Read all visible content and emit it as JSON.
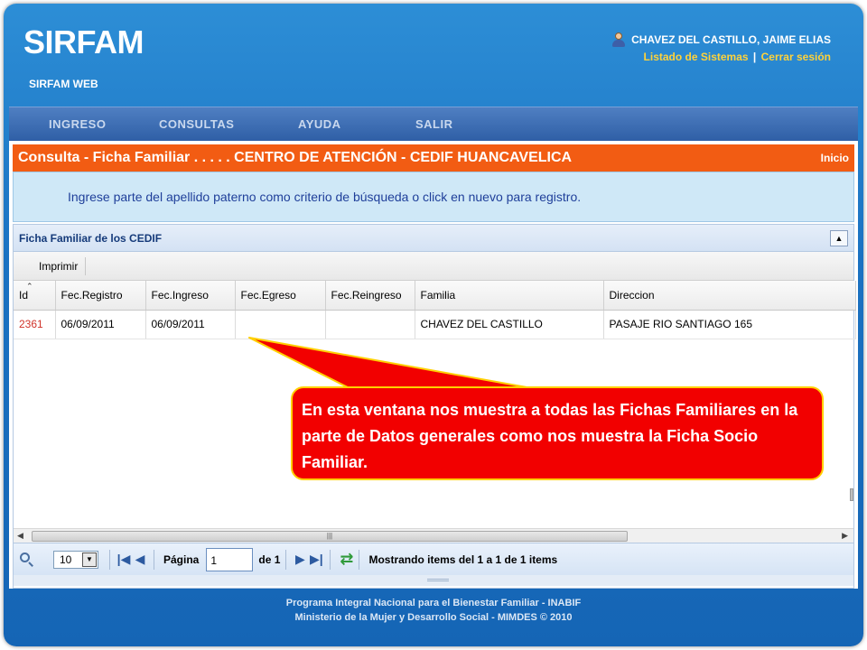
{
  "app": {
    "title": "SIRFAM",
    "subtitle": "SIRFAM WEB"
  },
  "user": {
    "name": "CHAVEZ DEL CASTILLO, JAIME ELIAS",
    "link_systems": "Listado de Sistemas",
    "separator": "|",
    "link_logout": "Cerrar sesión"
  },
  "menu": [
    {
      "label": "INGRESO"
    },
    {
      "label": "CONSULTAS"
    },
    {
      "label": "AYUDA"
    },
    {
      "label": "SALIR"
    }
  ],
  "page": {
    "title": "Consulta - Ficha Familiar . . . . . CENTRO DE ATENCIÓN - CEDIF HUANCAVELICA",
    "home_link": "Inicio",
    "info": "Ingrese parte del apellido paterno como criterio de búsqueda o click en nuevo para registro."
  },
  "grid": {
    "title": "Ficha Familiar de los CEDIF",
    "toolbar_print": "Imprimir",
    "columns": [
      "Id",
      "Fec.Registro",
      "Fec.Ingreso",
      "Fec.Egreso",
      "Fec.Reingreso",
      "Familia",
      "Direccion"
    ],
    "rows": [
      [
        "2361",
        "06/09/2011",
        "06/09/2011",
        "",
        "",
        "CHAVEZ DEL CASTILLO",
        "PASAJE RIO SANTIAGO 165"
      ]
    ]
  },
  "pager": {
    "page_size": "10",
    "page_label": "Página",
    "current_page": "1",
    "of_label": "de 1",
    "status": "Mostrando items del 1 a 1 de 1 items"
  },
  "callout": {
    "text": "En esta ventana nos muestra a todas las Fichas Familiares en la parte de Datos generales  como nos muestra la Ficha Socio Familiar."
  },
  "footer": {
    "line1": "Programa Integral Nacional para el Bienestar Familiar - INABIF",
    "line2": "Ministerio de la Mujer y Desarrollo Social - MIMDES © 2010"
  },
  "colors": {
    "accent_orange": "#f25c13",
    "callout_red": "#f20000",
    "callout_border": "#ffd000",
    "frame_blue": "#1a72c2"
  }
}
